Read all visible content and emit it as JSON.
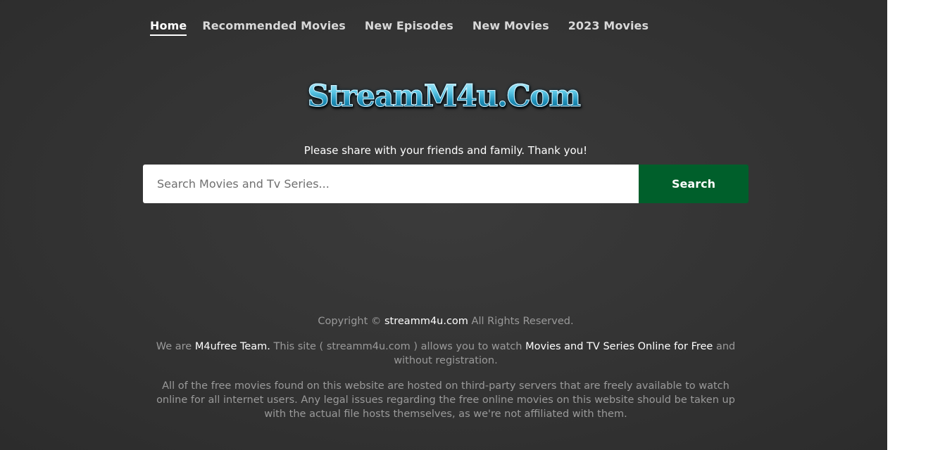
{
  "nav": {
    "items": [
      {
        "label": "Home",
        "active": true
      },
      {
        "label": "Recommended Movies",
        "active": false
      },
      {
        "label": "New Episodes",
        "active": false
      },
      {
        "label": "New Movies",
        "active": false
      },
      {
        "label": "2023 Movies",
        "active": false
      }
    ]
  },
  "logo": {
    "text": "StreamM4u.Com"
  },
  "tagline": "Please share with your friends and family. Thank you!",
  "search": {
    "placeholder": "Search Movies and Tv Series...",
    "value": "",
    "button_label": "Search"
  },
  "footer": {
    "copyright_prefix": "Copyright ©",
    "copyright_site": "streamm4u.com",
    "copyright_suffix": "All Rights Reserved.",
    "about_we_are": "We are",
    "about_team": "M4ufree Team.",
    "about_middle": "This site ( streamm4u.com ) allows you to watch",
    "about_link": "Movies and TV Series Online for Free",
    "about_end": "and without registration.",
    "disclaimer": "All of the free movies found on this website are hosted on third-party servers that are freely available to watch online for all internet users. Any legal issues regarding the free online movies on this website should be taken up with the actual file hosts themselves, as we're not affiliated with them."
  },
  "colors": {
    "background": "#333333",
    "search_button": "#005f2b",
    "footer_text": "#9a9a9a",
    "highlight_text": "#ffffff",
    "logo": "#35b6d8"
  }
}
